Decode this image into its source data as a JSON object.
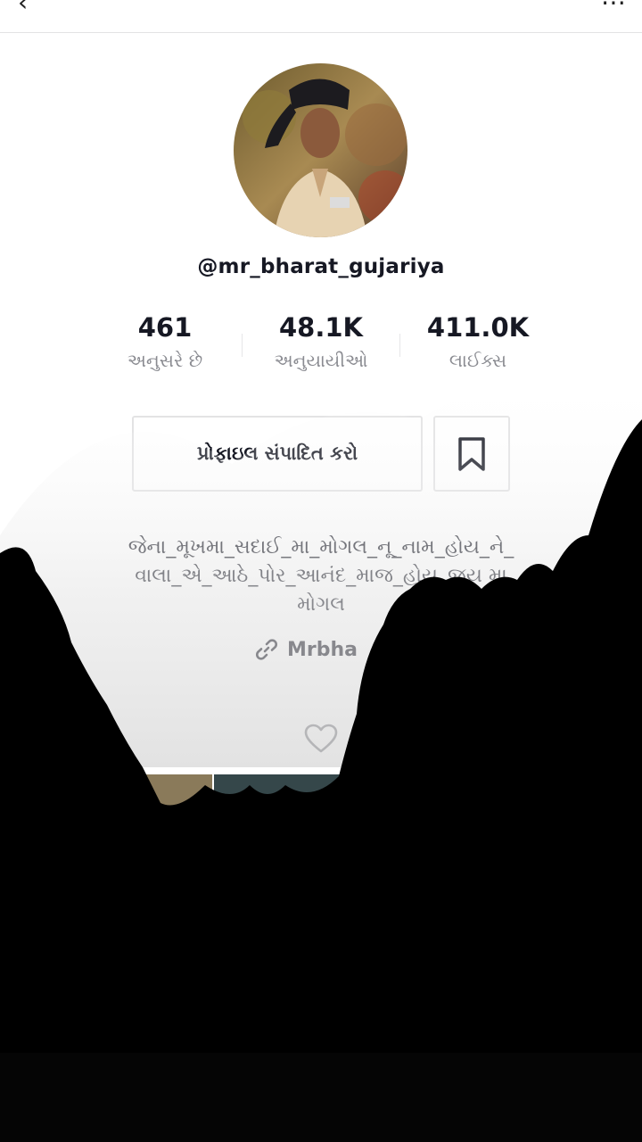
{
  "profile": {
    "username": "@mr_bharat_gujariya",
    "stats": [
      {
        "value": "461",
        "label": "અનુસરે છે"
      },
      {
        "value": "48.1K",
        "label": "અનુયાયીઓ"
      },
      {
        "value": "411.0K",
        "label": "લાઈક્સ"
      }
    ],
    "edit_button_label": "પ્રોફાઇલ સંપાદિત કરો",
    "bio_line1": "જેના_મૂખમા_સદાઈ_મા_મોગલ_નૂ_નામ_હોય_ને_",
    "bio_line2": "વાલા_એ_આઠે_પોર_આનંદ_માજ_હોય_જય મા",
    "bio_line3": "મોગલ",
    "link_text": "Mrbha"
  },
  "icons": {
    "bookmark": "bookmark-icon",
    "link": "link-icon",
    "grid": "grid-icon",
    "heart": "heart-outline-icon"
  },
  "colors": {
    "text_primary": "#161823",
    "text_secondary": "#8a8b91",
    "border": "#e3e3e4"
  }
}
